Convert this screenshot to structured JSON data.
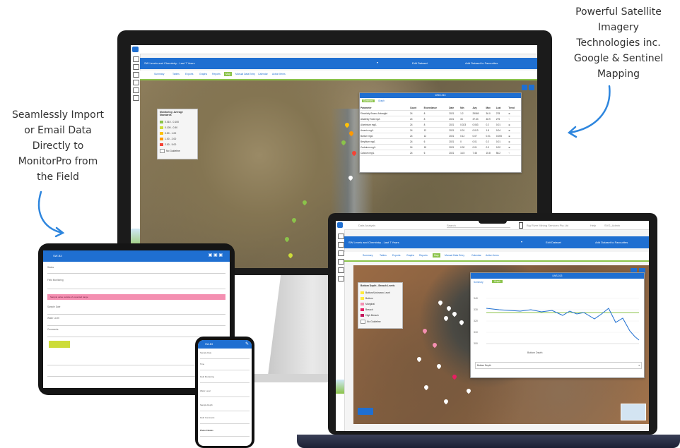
{
  "callouts": {
    "left": [
      "Seamlessly Import",
      "or Email Data",
      "Directly to",
      "MonitorPro from",
      "the Field"
    ],
    "right": [
      "Powerful Satellite",
      "Imagery",
      "Technologies inc.",
      "Google & Sentinel",
      "Mapping"
    ]
  },
  "monitor": {
    "header_title": "SW Levels and Chemistry - Last 7 Years",
    "edit_dataset": "Edit Dataset",
    "add_dataset": "Add Dataset to Favourites",
    "tabs": [
      "Summary",
      "Tables",
      "Exports",
      "Graphs",
      "Reports",
      "Map",
      "Manual Data Entry",
      "Calendar",
      "Action Items"
    ],
    "active_tab_index": 5,
    "legend_title": "Monitoring: Average Standards",
    "legend_items": [
      {
        "label": "0.010 - 0.100",
        "color": "#8bc34a"
      },
      {
        "label": "0.100 - 0.50",
        "color": "#cddc39"
      },
      {
        "label": "0.50 - 1.00",
        "color": "#ffc107"
      },
      {
        "label": "1.00 - 2.00",
        "color": "#ff9800"
      },
      {
        "label": "2.00 - 5.00",
        "color": "#f44336"
      },
      {
        "label": "No Guideline",
        "color": "#ffffff"
      }
    ],
    "panel_title": "WBO-013",
    "panel_tabs": [
      "Summary",
      "Graph"
    ],
    "table_headers": [
      "Parameter",
      "Count",
      "Exceedance",
      "Date",
      "Min",
      "Avg",
      "Max",
      "Last",
      "Trend"
    ],
    "table_rows": [
      [
        "Electricity Bromo Arbosight",
        "24",
        "8",
        "2021",
        "1.2",
        "29069",
        "36.0",
        "278",
        "⊕"
      ],
      [
        "Alkalinity Total mg/L",
        "24",
        "8",
        "2021",
        "34",
        "37.63",
        "48.9",
        "275",
        "↑"
      ],
      [
        "Aluminium mg/L",
        "24",
        "8",
        "2021",
        "0.023",
        "0.063",
        "0.2",
        "0.01",
        "⊕"
      ],
      [
        "Arsenic mg/L",
        "24",
        "12",
        "2021",
        "0.01",
        "0.013",
        "1.8",
        "0.04",
        "⊕"
      ],
      [
        "Barium mg/L",
        "24",
        "12",
        "2021",
        "0.12",
        "0.07",
        "0.01",
        "0.005",
        "⊕"
      ],
      [
        "Beryllium mg/L",
        "24",
        "6",
        "2021",
        "0",
        "0.01",
        "0.2",
        "0.01",
        "⊕"
      ],
      [
        "Cadmium mg/L",
        "24",
        "15",
        "2021",
        "0.02",
        "0.01",
        "0.3",
        "0.02",
        "⊕"
      ],
      [
        "Calcium mg/L",
        "24",
        "6",
        "2021",
        "14.5",
        "7.46",
        "15.8",
        "58.2",
        "↑"
      ]
    ]
  },
  "tablet": {
    "header": "SW-B3",
    "rows": [
      "Status",
      "Field Monitoring",
      "Sample Date",
      "Water Level",
      "Comments"
    ],
    "alert": "Sample value outside of expected range"
  },
  "laptop": {
    "topbar_left": "Data Analysis",
    "topbar_search": "Search",
    "topbar_right": "Big River Mining Services Pty Ltd",
    "topbar_help": "Help",
    "topbar_user": "SVG_Admin",
    "header_title": "SW Levels and Chemistry - Last 7 Years",
    "edit_dataset": "Edit Dataset",
    "add_dataset": "Add Dataset to Favourites",
    "tabs": [
      "Summary",
      "Tables",
      "Exports",
      "Graphs",
      "Reports",
      "Map",
      "Manual Data Entry",
      "Calendar",
      "Action Items"
    ],
    "active_tab_index": 5,
    "legend_title": "Bottom Depth - Breach Levels",
    "legend_items": [
      {
        "label": "Bottom/Unknown Level",
        "color": "#ffeb3b"
      },
      {
        "label": "Bottom",
        "color": "#ffeb3b"
      },
      {
        "label": "Marginal",
        "color": "#f48fb1"
      },
      {
        "label": "Breach",
        "color": "#e91e63"
      },
      {
        "label": "High Breach",
        "color": "#c2185b"
      },
      {
        "label": "No Guideline",
        "color": "#ffffff"
      }
    ],
    "panel_title": "LWS-013",
    "panel_tabs": [
      "Summary",
      "Graph"
    ],
    "graph_legend": "Bottom Depth",
    "graph_select": "Bottom Depth",
    "chart_yticks": [
      "340",
      "330",
      "320",
      "310",
      "300"
    ]
  },
  "phone": {
    "header": "SW-B3",
    "rows": [
      "Sample Date",
      "Time",
      "Field Monitoring",
      "Water Level",
      "Sample Depth",
      "Field Comments",
      "Photo Checks"
    ]
  },
  "colors": {
    "brand_blue": "#1f6fd1",
    "active_green": "#8bc34a"
  }
}
